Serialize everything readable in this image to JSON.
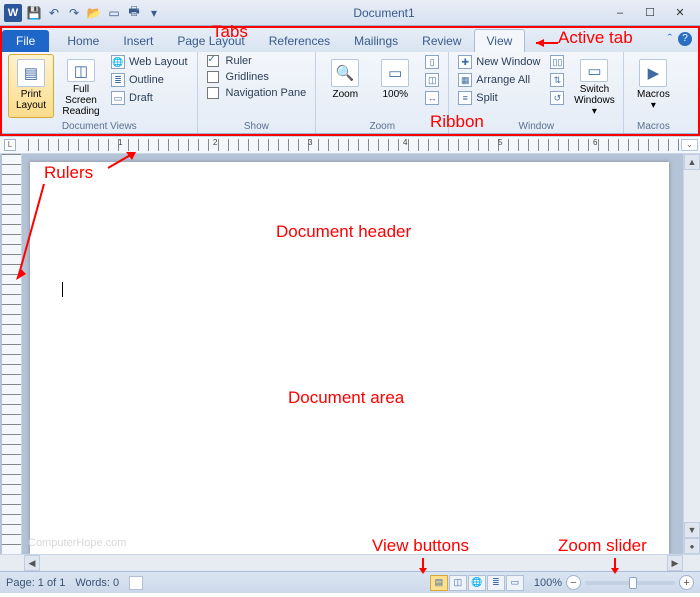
{
  "title": "Document1",
  "qat_icons": [
    "save-icon",
    "undo-icon",
    "redo-icon",
    "open-icon",
    "new-icon",
    "quickprint-icon",
    "printpreview-icon"
  ],
  "window_controls": {
    "min": "–",
    "max": "☐",
    "close": "✕"
  },
  "tabs": {
    "file": "File",
    "items": [
      "Home",
      "Insert",
      "Page Layout",
      "References",
      "Mailings",
      "Review",
      "View"
    ],
    "active": "View"
  },
  "ribbon": {
    "document_views": {
      "print_layout": "Print Layout",
      "full_screen_reading": "Full Screen Reading",
      "web_layout": "Web Layout",
      "outline": "Outline",
      "draft": "Draft",
      "group_label": "Document Views"
    },
    "show": {
      "ruler": "Ruler",
      "gridlines": "Gridlines",
      "navigation_pane": "Navigation Pane",
      "group_label": "Show"
    },
    "zoom": {
      "zoom": "Zoom",
      "hundred": "100%",
      "group_label": "Zoom"
    },
    "window": {
      "new_window": "New Window",
      "arrange_all": "Arrange All",
      "split": "Split",
      "switch_windows": "Switch Windows",
      "group_label": "Window"
    },
    "macros": {
      "macros": "Macros",
      "group_label": "Macros"
    }
  },
  "ruler_numbers": [
    "1",
    "2",
    "3",
    "4",
    "5",
    "6"
  ],
  "status": {
    "page": "Page: 1 of 1",
    "words": "Words: 0",
    "zoom_pct": "100%"
  },
  "annotations": {
    "tabs": "Tabs",
    "active_tab": "Active tab",
    "rulers": "Rulers",
    "ribbon": "Ribbon",
    "doc_header": "Document header",
    "doc_area": "Document area",
    "view_buttons": "View buttons",
    "zoom_slider": "Zoom slider"
  },
  "watermark": "ComputerHope.com"
}
